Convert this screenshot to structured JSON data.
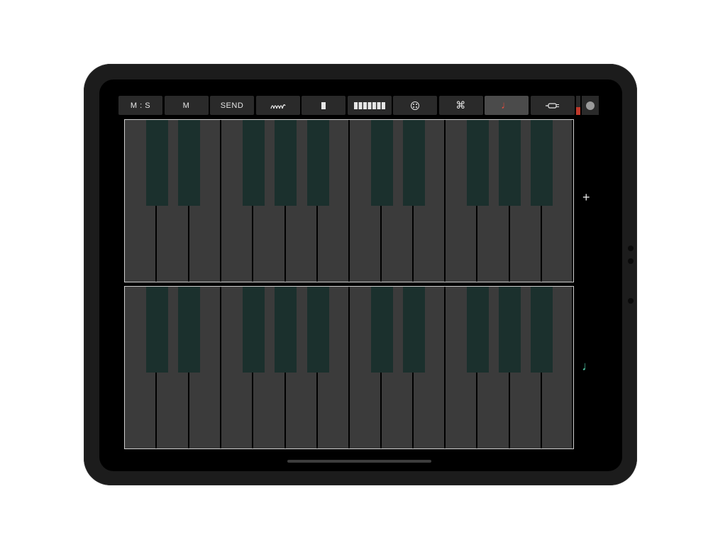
{
  "toolbar": {
    "buttons": [
      {
        "label": "M : S",
        "name": "ms-button",
        "active": false
      },
      {
        "label": "M",
        "name": "m-button",
        "active": false
      },
      {
        "label": "SEND",
        "name": "send-button",
        "active": false
      },
      {
        "label": "",
        "icon": "arpeggio-icon",
        "name": "arpeggio-button",
        "active": false
      },
      {
        "label": "",
        "icon": "single-bar-icon",
        "name": "single-key-mode-button",
        "active": false
      },
      {
        "label": "",
        "icon": "multi-bar-icon",
        "name": "multi-key-mode-button",
        "active": false
      },
      {
        "label": "",
        "icon": "circle-pattern-icon",
        "name": "pattern-button",
        "active": false
      },
      {
        "label": "⌘",
        "icon": "command-icon",
        "name": "command-button",
        "active": false
      },
      {
        "label": "♩",
        "icon": "note-icon",
        "name": "note-mode-button",
        "active": true
      },
      {
        "label": "",
        "icon": "cable-icon",
        "name": "midi-cable-button",
        "active": false
      }
    ],
    "level_fraction": 0.4,
    "record_icon": "record-icon"
  },
  "side": {
    "add_label": "+",
    "note_label": "♩"
  },
  "colors": {
    "white_key": "#3b3b3b",
    "black_key": "#1b302d",
    "active_note": "#e74c3c",
    "side_note": "#4fc3a1",
    "level": "#c0392b"
  }
}
